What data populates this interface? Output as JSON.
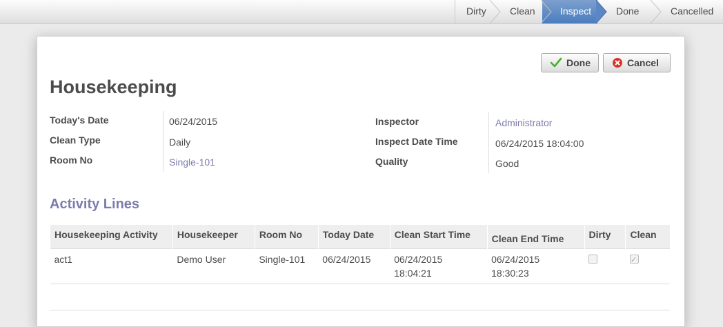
{
  "stages": [
    {
      "label": "Dirty",
      "active": false
    },
    {
      "label": "Clean",
      "active": false
    },
    {
      "label": "Inspect",
      "active": true
    },
    {
      "label": "Done",
      "active": false
    },
    {
      "label": "Cancelled",
      "active": false
    }
  ],
  "buttons": {
    "done": "Done",
    "cancel": "Cancel"
  },
  "form": {
    "title": "Housekeeping",
    "todays_date_label": "Today's Date",
    "todays_date": "06/24/2015",
    "clean_type_label": "Clean Type",
    "clean_type": "Daily",
    "room_no_label": "Room No",
    "room_no": "Single-101",
    "inspector_label": "Inspector",
    "inspector": "Administrator",
    "inspect_datetime_label": "Inspect Date Time",
    "inspect_datetime": "06/24/2015 18:04:00",
    "quality_label": "Quality",
    "quality": "Good"
  },
  "activity": {
    "title": "Activity Lines",
    "columns": [
      "Housekeeping Activity",
      "Housekeeper",
      "Room No",
      "Today Date",
      "Clean Start Time",
      "Clean End Time",
      "Dirty",
      "Clean"
    ],
    "rows": [
      {
        "activity": "act1",
        "housekeeper": "Demo User",
        "room_no": "Single-101",
        "today_date": "06/24/2015",
        "start_date": "06/24/2015",
        "start_time": "18:04:21",
        "end_date": "06/24/2015",
        "end_time": "18:30:23",
        "dirty": false,
        "clean": true
      }
    ]
  },
  "colors": {
    "accent": "#7c7bad",
    "active_stage": "#4a7cbf"
  }
}
